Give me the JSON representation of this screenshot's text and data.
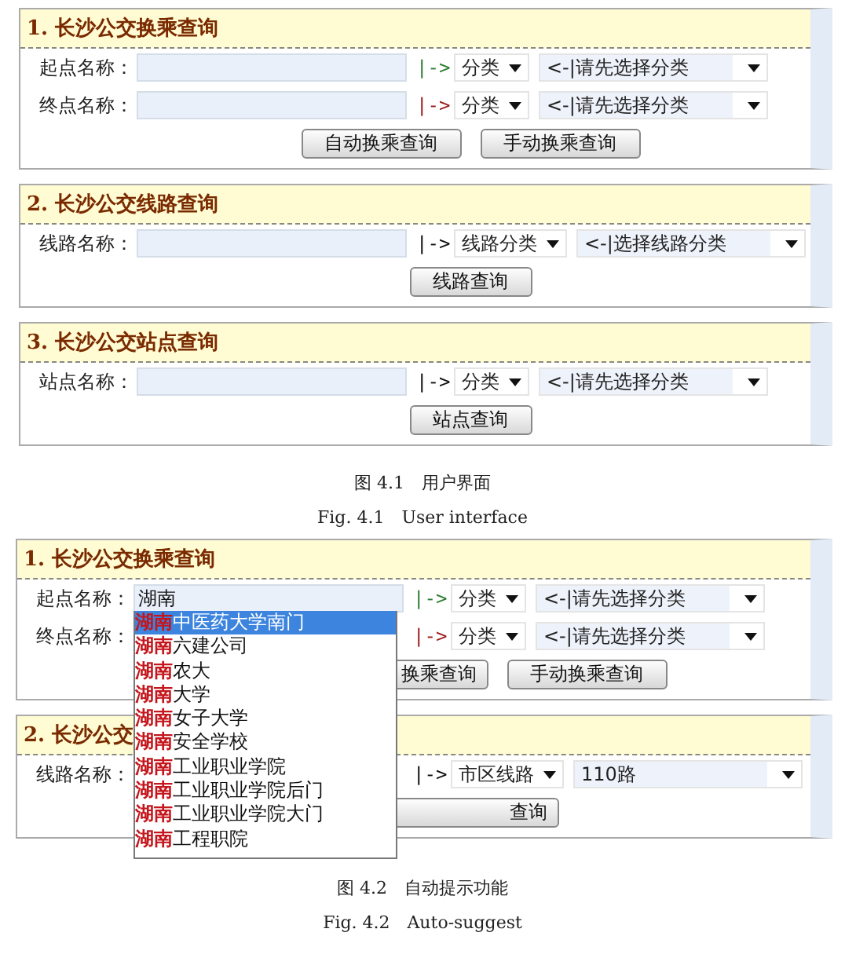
{
  "figures": [
    {
      "panels": [
        {
          "title": "1. 长沙公交换乘查询",
          "rows": [
            {
              "label": "起点名称：",
              "field_shown": true,
              "value": "",
              "arrow": "|->",
              "color": "#2e7d32",
              "category": "分类",
              "selection": "<-|请先选择分类"
            },
            {
              "label": "终点名称：",
              "field_shown": true,
              "value": "",
              "arrow": "|->",
              "color": "#9b1c1c",
              "category": "分类",
              "selection": "<-|请先选择分类"
            }
          ],
          "buttons": [
            {
              "label": "自动换乘查询",
              "clipped": false
            },
            {
              "label": "手动换乘查询",
              "clipped": false
            }
          ]
        },
        {
          "title": "2. 长沙公交线路查询",
          "rows": [
            {
              "label": "线路名称：",
              "field_shown": true,
              "value": "",
              "arrow": "|->",
              "color": "#111111",
              "category": "线路分类",
              "selection": "<-|选择线路分类"
            }
          ],
          "buttons": [
            {
              "label": "线路查询",
              "clipped": false
            }
          ]
        },
        {
          "title": "3. 长沙公交站点查询",
          "rows": [
            {
              "label": "站点名称：",
              "field_shown": true,
              "value": "",
              "arrow": "|->",
              "color": "#111111",
              "category": "分类",
              "selection": "<-|请先选择分类"
            }
          ],
          "buttons": [
            {
              "label": "站点查询",
              "clipped": false
            }
          ]
        }
      ],
      "caption": "图 4.1　用户界面",
      "caption_en": "Fig. 4.1　User interface"
    },
    {
      "panels": [
        {
          "title": "1. 长沙公交换乘查询",
          "rows": [
            {
              "label": "起点名称：",
              "field_shown": true,
              "value": "湖南",
              "arrow": "|->",
              "color": "#2e7d32",
              "category": "分类",
              "selection": "<-|请先选择分类"
            },
            {
              "label": "终点名称：",
              "field_shown": false,
              "value": "",
              "arrow": "|->",
              "color": "#9b1c1c",
              "category": "分类",
              "selection": "<-|请先选择分类"
            }
          ],
          "buttons": [
            {
              "label": "换乘查询",
              "clipped": true
            },
            {
              "label": "手动换乘查询",
              "clipped": false
            }
          ]
        },
        {
          "title": "2. 长沙公交",
          "rows": [
            {
              "label": "线路名称：",
              "field_shown": false,
              "value": "",
              "arrow": "|->",
              "color": "#111111",
              "category": "市区线路",
              "selection": "110路"
            }
          ],
          "buttons": [
            {
              "label": "查询",
              "clipped": true
            }
          ]
        }
      ],
      "suggestions": [
        {
          "match": "湖南",
          "rest": "中医药大学南门",
          "selected": true
        },
        {
          "match": "湖南",
          "rest": "六建公司",
          "selected": false
        },
        {
          "match": "湖南",
          "rest": "农大",
          "selected": false
        },
        {
          "match": "湖南",
          "rest": "大学",
          "selected": false
        },
        {
          "match": "湖南",
          "rest": "女子大学",
          "selected": false
        },
        {
          "match": "湖南",
          "rest": "安全学校",
          "selected": false
        },
        {
          "match": "湖南",
          "rest": "工业职业学院",
          "selected": false
        },
        {
          "match": "湖南",
          "rest": "工业职业学院后门",
          "selected": false
        },
        {
          "match": "湖南",
          "rest": "工业职业学院大门",
          "selected": false
        },
        {
          "match": "湖南",
          "rest": "工程职院",
          "selected": false
        }
      ],
      "caption": "图 4.2　自动提示功能",
      "caption_en": "Fig. 4.2　Auto-suggest"
    }
  ]
}
